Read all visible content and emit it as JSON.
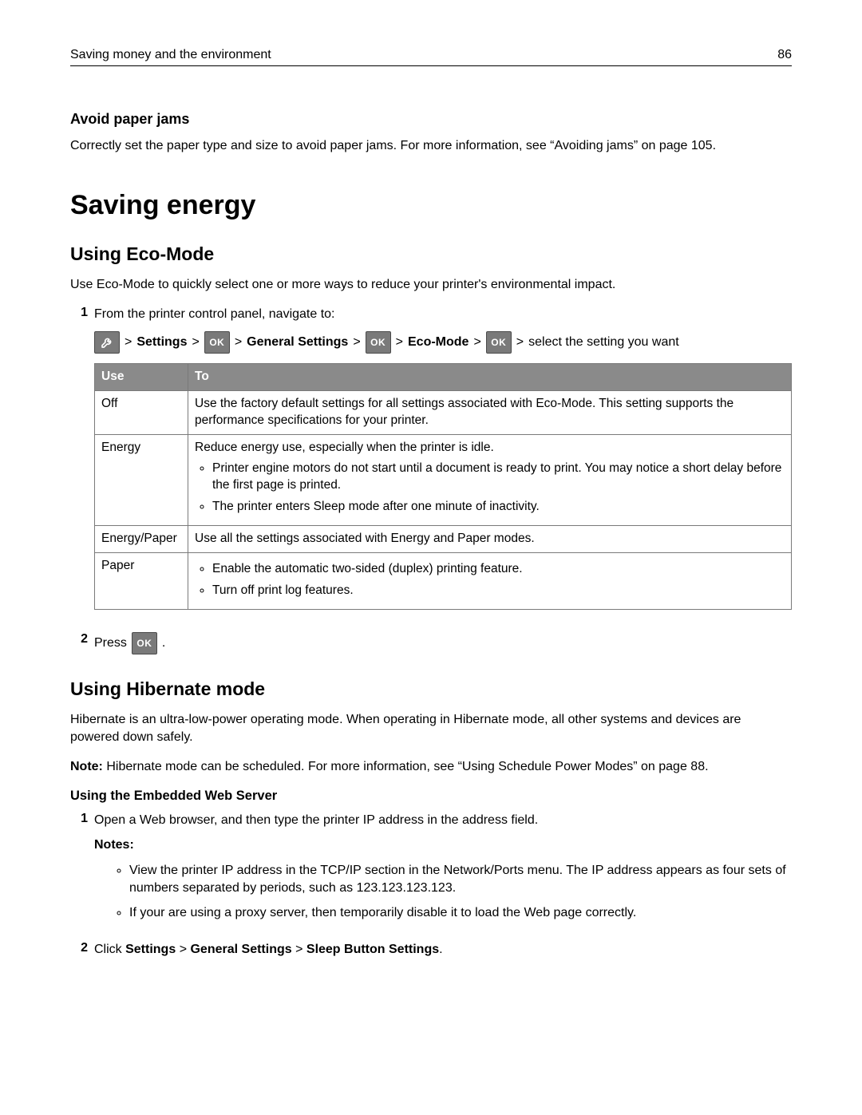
{
  "header": {
    "title": "Saving money and the environment",
    "page_number": "86"
  },
  "section_avoid": {
    "heading": "Avoid paper jams",
    "body": "Correctly set the paper type and size to avoid paper jams. For more information, see “Avoiding jams” on page 105."
  },
  "h1": "Saving energy",
  "eco": {
    "heading": "Using Eco-Mode",
    "intro": "Use Eco-Mode to quickly select one or more ways to reduce your printer's environmental impact.",
    "step1": "From the printer control panel, navigate to:",
    "nav": {
      "settings": "Settings",
      "general": "General Settings",
      "ecomode": "Eco-Mode",
      "tail": "select the setting you want",
      "gt": ">"
    },
    "table": {
      "head_use": "Use",
      "head_to": "To",
      "rows": {
        "off": {
          "use": "Off",
          "to": "Use the factory default settings for all settings associated with Eco-Mode. This setting supports the performance specifications for your printer."
        },
        "energy": {
          "use": "Energy",
          "to_lead": "Reduce energy use, especially when the printer is idle.",
          "bullets": [
            "Printer engine motors do not start until a document is ready to print. You may notice a short delay before the first page is printed.",
            "The printer enters Sleep mode after one minute of inactivity."
          ]
        },
        "energy_paper": {
          "use": "Energy/Paper",
          "to": "Use all the settings associated with Energy and Paper modes."
        },
        "paper": {
          "use": "Paper",
          "bullets": [
            "Enable the automatic two-sided (duplex) printing feature.",
            "Turn off print log features."
          ]
        }
      }
    },
    "step2_press": "Press",
    "period": "."
  },
  "hibernate": {
    "heading": "Using Hibernate mode",
    "p1": "Hibernate is an ultra-low-power operating mode. When operating in Hibernate mode, all other systems and devices are powered down safely.",
    "note_label": "Note:",
    "note_text": " Hibernate mode can be scheduled. For more information, see “Using Schedule Power Modes” on page 88.",
    "ews_heading": "Using the Embedded Web Server",
    "step1": "Open a Web browser, and then type the printer IP address in the address field.",
    "notes_label": "Notes:",
    "notes": [
      "View the printer IP address in the TCP/IP section in the Network/Ports menu. The IP address appears as four sets of numbers separated by periods, such as 123.123.123.123.",
      "If your are using a proxy server, then temporarily disable it to load the Web page correctly."
    ],
    "step2_prefix": "Click ",
    "step2_b1": "Settings",
    "step2_b2": "General Settings",
    "step2_b3": "Sleep Button Settings",
    "gt": ">",
    "step2_suffix": "."
  },
  "icons": {
    "ok": "OK"
  }
}
